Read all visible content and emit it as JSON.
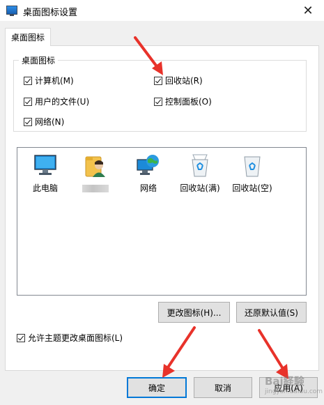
{
  "window": {
    "title": "桌面图标设置",
    "close_glyph": "✕"
  },
  "tab": {
    "label": "桌面图标"
  },
  "group": {
    "legend": "桌面图标",
    "checkboxes": [
      {
        "label": "计算机(M)",
        "checked": true
      },
      {
        "label": "回收站(R)",
        "checked": true
      },
      {
        "label": "用户的文件(U)",
        "checked": true
      },
      {
        "label": "控制面板(O)",
        "checked": true
      },
      {
        "label": "网络(N)",
        "checked": true
      }
    ]
  },
  "icons": [
    {
      "label": "此电脑",
      "icon": "this-pc-icon"
    },
    {
      "label": "",
      "icon": "user-folder-icon"
    },
    {
      "label": "网络",
      "icon": "network-icon"
    },
    {
      "label": "回收站(满)",
      "icon": "recycle-bin-full-icon"
    },
    {
      "label": "回收站(空)",
      "icon": "recycle-bin-empty-icon"
    }
  ],
  "buttons": {
    "change_icon": "更改图标(H)...",
    "restore_default": "还原默认值(S)",
    "ok": "确定",
    "cancel": "取消",
    "apply": "应用(A)"
  },
  "theme_checkbox": {
    "label": "允许主题更改桌面图标(L)",
    "checked": true
  },
  "watermark": {
    "text": "Bai経験",
    "sub": "jingyan.baidu.com"
  },
  "colors": {
    "annotation_red": "#e8322a",
    "focus_blue": "#0078d7"
  }
}
